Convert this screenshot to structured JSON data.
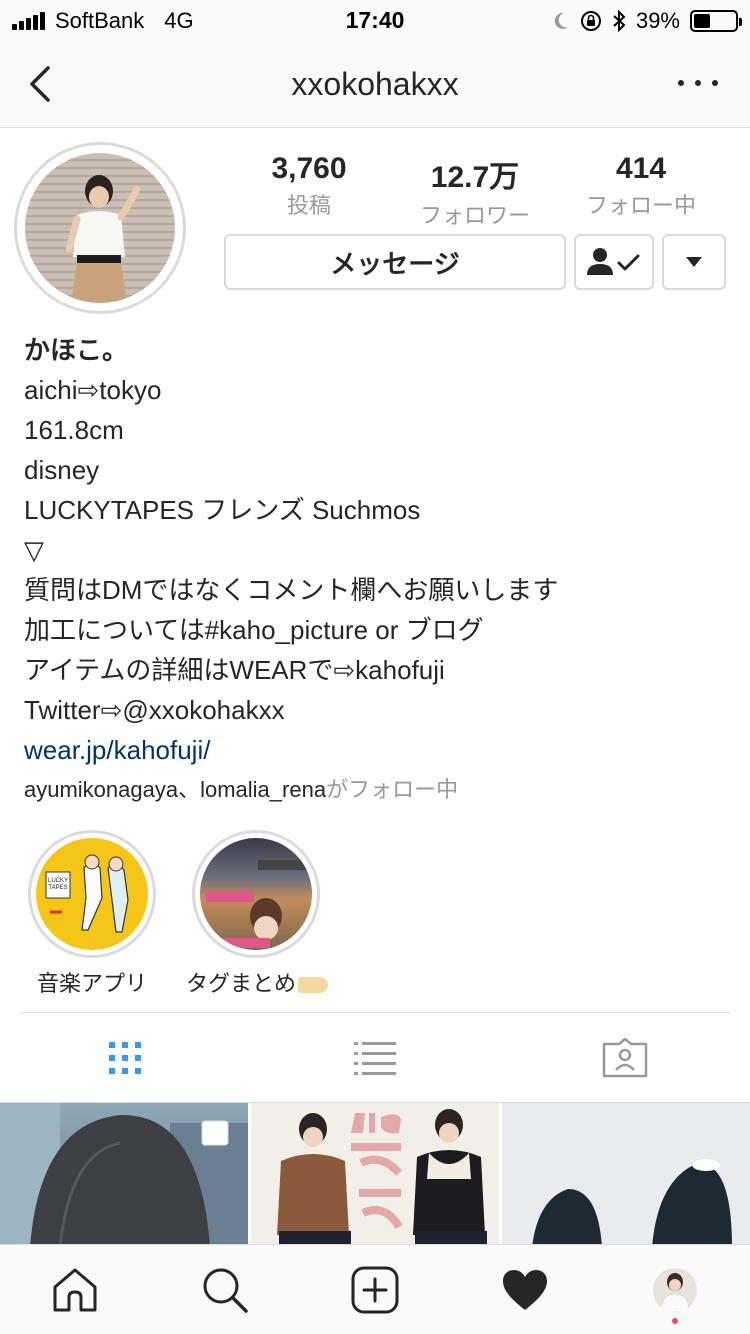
{
  "status_bar": {
    "carrier": "SoftBank",
    "network": "4G",
    "time": "17:40",
    "battery_percent": "39%",
    "battery_level": 0.39,
    "icons": [
      "signal-icon",
      "moon-icon",
      "rotation-lock-icon",
      "bluetooth-icon",
      "battery-icon"
    ]
  },
  "nav": {
    "title": "xxokohakxx",
    "icons": [
      "back-chevron-icon",
      "more-dots-icon"
    ]
  },
  "profile": {
    "stats": [
      {
        "value": "3,760",
        "label": "投稿"
      },
      {
        "value": "12.7万",
        "label": "フォロワー"
      },
      {
        "value": "414",
        "label": "フォロー中"
      }
    ],
    "message_button": "メッセージ",
    "icons": [
      "following-person-check-icon",
      "dropdown-triangle-icon"
    ]
  },
  "bio": {
    "name": "かほこ。",
    "lines": [
      "aichi⇨tokyo",
      "161.8cm",
      "disney",
      "LUCKYTAPES フレンズ Suchmos",
      "▽",
      "質問はDMではなくコメント欄へお願いします",
      "加工については#kaho_picture or ブログ",
      "アイテムの詳細はWEARで⇨kahofuji",
      "Twitter⇨@xxokohakxx"
    ],
    "link": "wear.jp/kahofuji/",
    "followed_by_names": "ayumikonagaya、lomalia_rena",
    "followed_by_suffix": "がフォロー中"
  },
  "highlights": [
    {
      "label": "音楽アプリ"
    },
    {
      "label": "タグまとめ"
    }
  ],
  "view_tabs": {
    "active": "grid",
    "icons": [
      "grid-icon",
      "list-icon",
      "tagged-icon"
    ],
    "active_color": "#3897f0"
  },
  "tab_bar": {
    "icons": [
      "home-icon",
      "search-icon",
      "add-post-icon",
      "activity-heart-icon",
      "profile-avatar"
    ],
    "notification_color": "#ed4956"
  },
  "colors": {
    "link": "#003569",
    "muted": "#999999",
    "text": "#262626",
    "border": "#dbdbdb"
  }
}
